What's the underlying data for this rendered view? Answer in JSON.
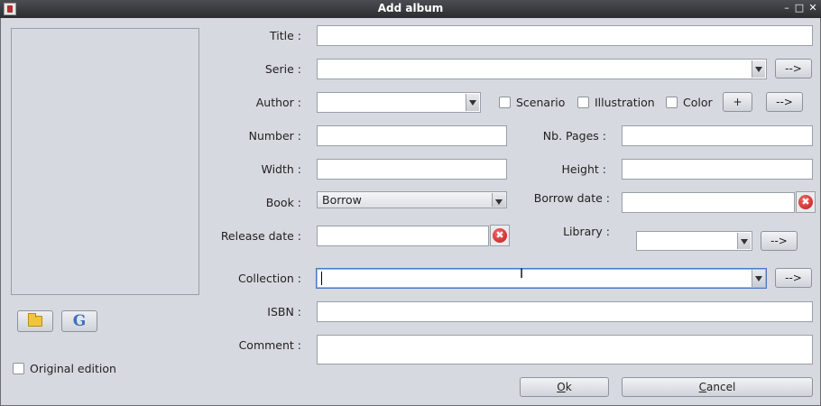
{
  "window": {
    "title": "Add album",
    "minimize": "–",
    "maximize": "□",
    "close": "✕"
  },
  "labels": {
    "title": "Title :",
    "serie": "Serie :",
    "author": "Author :",
    "number": "Number :",
    "width": "Width :",
    "book": "Book :",
    "release_date": "Release date :",
    "collection": "Collection :",
    "isbn": "ISBN :",
    "comment": "Comment :",
    "nb_pages": "Nb. Pages :",
    "height": "Height :",
    "borrow_date": "Borrow date :",
    "library": "Library :"
  },
  "checkboxes": {
    "scenario": "Scenario",
    "illustration": "Illustration",
    "color": "Color",
    "original_edition": "Original edition"
  },
  "buttons": {
    "goto": "-->",
    "add": "+",
    "ok_mnemonic": "O",
    "ok_rest": "k",
    "cancel_mnemonic": "C",
    "cancel_rest": "ancel"
  },
  "book_select": {
    "value": "Borrow"
  },
  "icons": {
    "folder": "folder-icon",
    "google": "G",
    "clear": "✖",
    "ibeam": "I"
  }
}
